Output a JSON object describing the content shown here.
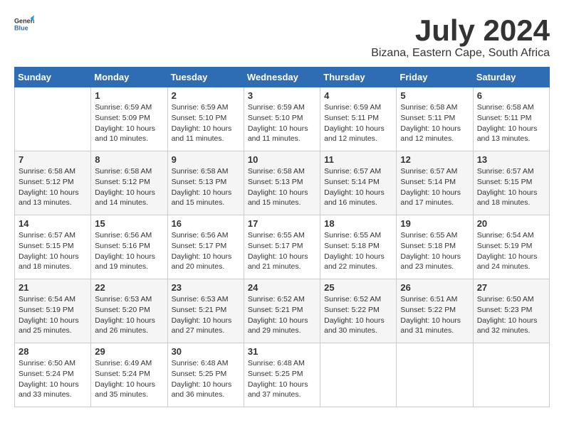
{
  "logo": {
    "general": "General",
    "blue": "Blue"
  },
  "title": {
    "month": "July 2024",
    "location": "Bizana, Eastern Cape, South Africa"
  },
  "calendar": {
    "headers": [
      "Sunday",
      "Monday",
      "Tuesday",
      "Wednesday",
      "Thursday",
      "Friday",
      "Saturday"
    ],
    "weeks": [
      [
        {
          "day": "",
          "sunrise": "",
          "sunset": "",
          "daylight": "",
          "empty": true
        },
        {
          "day": "1",
          "sunrise": "Sunrise: 6:59 AM",
          "sunset": "Sunset: 5:09 PM",
          "daylight": "Daylight: 10 hours and 10 minutes."
        },
        {
          "day": "2",
          "sunrise": "Sunrise: 6:59 AM",
          "sunset": "Sunset: 5:10 PM",
          "daylight": "Daylight: 10 hours and 11 minutes."
        },
        {
          "day": "3",
          "sunrise": "Sunrise: 6:59 AM",
          "sunset": "Sunset: 5:10 PM",
          "daylight": "Daylight: 10 hours and 11 minutes."
        },
        {
          "day": "4",
          "sunrise": "Sunrise: 6:59 AM",
          "sunset": "Sunset: 5:11 PM",
          "daylight": "Daylight: 10 hours and 12 minutes."
        },
        {
          "day": "5",
          "sunrise": "Sunrise: 6:58 AM",
          "sunset": "Sunset: 5:11 PM",
          "daylight": "Daylight: 10 hours and 12 minutes."
        },
        {
          "day": "6",
          "sunrise": "Sunrise: 6:58 AM",
          "sunset": "Sunset: 5:11 PM",
          "daylight": "Daylight: 10 hours and 13 minutes."
        }
      ],
      [
        {
          "day": "7",
          "sunrise": "Sunrise: 6:58 AM",
          "sunset": "Sunset: 5:12 PM",
          "daylight": "Daylight: 10 hours and 13 minutes."
        },
        {
          "day": "8",
          "sunrise": "Sunrise: 6:58 AM",
          "sunset": "Sunset: 5:12 PM",
          "daylight": "Daylight: 10 hours and 14 minutes."
        },
        {
          "day": "9",
          "sunrise": "Sunrise: 6:58 AM",
          "sunset": "Sunset: 5:13 PM",
          "daylight": "Daylight: 10 hours and 15 minutes."
        },
        {
          "day": "10",
          "sunrise": "Sunrise: 6:58 AM",
          "sunset": "Sunset: 5:13 PM",
          "daylight": "Daylight: 10 hours and 15 minutes."
        },
        {
          "day": "11",
          "sunrise": "Sunrise: 6:57 AM",
          "sunset": "Sunset: 5:14 PM",
          "daylight": "Daylight: 10 hours and 16 minutes."
        },
        {
          "day": "12",
          "sunrise": "Sunrise: 6:57 AM",
          "sunset": "Sunset: 5:14 PM",
          "daylight": "Daylight: 10 hours and 17 minutes."
        },
        {
          "day": "13",
          "sunrise": "Sunrise: 6:57 AM",
          "sunset": "Sunset: 5:15 PM",
          "daylight": "Daylight: 10 hours and 18 minutes."
        }
      ],
      [
        {
          "day": "14",
          "sunrise": "Sunrise: 6:57 AM",
          "sunset": "Sunset: 5:15 PM",
          "daylight": "Daylight: 10 hours and 18 minutes."
        },
        {
          "day": "15",
          "sunrise": "Sunrise: 6:56 AM",
          "sunset": "Sunset: 5:16 PM",
          "daylight": "Daylight: 10 hours and 19 minutes."
        },
        {
          "day": "16",
          "sunrise": "Sunrise: 6:56 AM",
          "sunset": "Sunset: 5:17 PM",
          "daylight": "Daylight: 10 hours and 20 minutes."
        },
        {
          "day": "17",
          "sunrise": "Sunrise: 6:55 AM",
          "sunset": "Sunset: 5:17 PM",
          "daylight": "Daylight: 10 hours and 21 minutes."
        },
        {
          "day": "18",
          "sunrise": "Sunrise: 6:55 AM",
          "sunset": "Sunset: 5:18 PM",
          "daylight": "Daylight: 10 hours and 22 minutes."
        },
        {
          "day": "19",
          "sunrise": "Sunrise: 6:55 AM",
          "sunset": "Sunset: 5:18 PM",
          "daylight": "Daylight: 10 hours and 23 minutes."
        },
        {
          "day": "20",
          "sunrise": "Sunrise: 6:54 AM",
          "sunset": "Sunset: 5:19 PM",
          "daylight": "Daylight: 10 hours and 24 minutes."
        }
      ],
      [
        {
          "day": "21",
          "sunrise": "Sunrise: 6:54 AM",
          "sunset": "Sunset: 5:19 PM",
          "daylight": "Daylight: 10 hours and 25 minutes."
        },
        {
          "day": "22",
          "sunrise": "Sunrise: 6:53 AM",
          "sunset": "Sunset: 5:20 PM",
          "daylight": "Daylight: 10 hours and 26 minutes."
        },
        {
          "day": "23",
          "sunrise": "Sunrise: 6:53 AM",
          "sunset": "Sunset: 5:21 PM",
          "daylight": "Daylight: 10 hours and 27 minutes."
        },
        {
          "day": "24",
          "sunrise": "Sunrise: 6:52 AM",
          "sunset": "Sunset: 5:21 PM",
          "daylight": "Daylight: 10 hours and 29 minutes."
        },
        {
          "day": "25",
          "sunrise": "Sunrise: 6:52 AM",
          "sunset": "Sunset: 5:22 PM",
          "daylight": "Daylight: 10 hours and 30 minutes."
        },
        {
          "day": "26",
          "sunrise": "Sunrise: 6:51 AM",
          "sunset": "Sunset: 5:22 PM",
          "daylight": "Daylight: 10 hours and 31 minutes."
        },
        {
          "day": "27",
          "sunrise": "Sunrise: 6:50 AM",
          "sunset": "Sunset: 5:23 PM",
          "daylight": "Daylight: 10 hours and 32 minutes."
        }
      ],
      [
        {
          "day": "28",
          "sunrise": "Sunrise: 6:50 AM",
          "sunset": "Sunset: 5:24 PM",
          "daylight": "Daylight: 10 hours and 33 minutes."
        },
        {
          "day": "29",
          "sunrise": "Sunrise: 6:49 AM",
          "sunset": "Sunset: 5:24 PM",
          "daylight": "Daylight: 10 hours and 35 minutes."
        },
        {
          "day": "30",
          "sunrise": "Sunrise: 6:48 AM",
          "sunset": "Sunset: 5:25 PM",
          "daylight": "Daylight: 10 hours and 36 minutes."
        },
        {
          "day": "31",
          "sunrise": "Sunrise: 6:48 AM",
          "sunset": "Sunset: 5:25 PM",
          "daylight": "Daylight: 10 hours and 37 minutes."
        },
        {
          "day": "",
          "sunrise": "",
          "sunset": "",
          "daylight": "",
          "empty": true
        },
        {
          "day": "",
          "sunrise": "",
          "sunset": "",
          "daylight": "",
          "empty": true
        },
        {
          "day": "",
          "sunrise": "",
          "sunset": "",
          "daylight": "",
          "empty": true
        }
      ]
    ]
  }
}
